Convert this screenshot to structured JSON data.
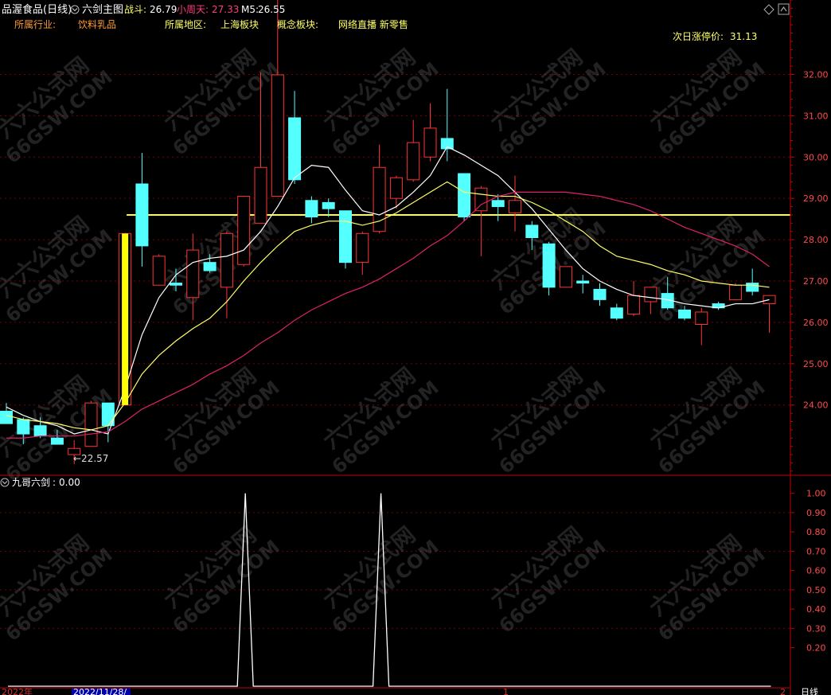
{
  "header": {
    "stock_name": "品渥食品(日线)",
    "indicator_name": "六剑主图",
    "zhandou_label": "战斗:",
    "zhandou_value": "26.79",
    "xiaozhoutian_label": "小周天:",
    "xiaozhoutian_value": "27.33",
    "m5_label": "M5:",
    "m5_value": "26.55"
  },
  "info": {
    "industry_label": "所属行业:",
    "industry_value": "饮料乳品",
    "region_label": "所属地区:",
    "region_value": "上海板块",
    "concept_label": "概念板块:",
    "concept_value": "网络直播 新零售",
    "limit_label": "次日涨停价:",
    "limit_value": "31.13"
  },
  "sub_header": {
    "name": "九哥六剑",
    "value": "0.00"
  },
  "bottom_bar": {
    "year": "2022年",
    "date": "2022/11/28/",
    "mark1": "1",
    "mark2": "2",
    "period": "日线"
  },
  "watermark": "六六公式网\n66GSW.COM",
  "colors": {
    "up": "#ff3333",
    "down": "#54ffff",
    "ma_white": "#ffffff",
    "ma_yellow": "#ffff66",
    "ma_pink": "#e0206a",
    "hline": "#ffff33",
    "grid": "#7a0000",
    "axis": "#c00000",
    "axis_text": "#ff4a4a"
  },
  "chart_data": [
    {
      "type": "candlestick",
      "title": "六剑主图",
      "ylim": [
        22.3,
        33.8
      ],
      "y_ticks": [
        24.0,
        25.0,
        26.0,
        27.0,
        28.0,
        29.0,
        30.0,
        31.0,
        32.0
      ],
      "y_tick_labels": [
        "24.00",
        "25.00",
        "26.00",
        "27.00",
        "28.00",
        "29.00",
        "30.00",
        "31.00",
        "32.00"
      ],
      "low_annotation": "←22.57",
      "hline_value": 28.6,
      "candles": [
        {
          "o": 23.85,
          "h": 24.05,
          "l": 23.55,
          "c": 23.55
        },
        {
          "o": 23.65,
          "h": 23.7,
          "l": 23.05,
          "c": 23.3
        },
        {
          "o": 23.5,
          "h": 23.7,
          "l": 23.2,
          "c": 23.25
        },
        {
          "o": 23.2,
          "h": 23.4,
          "l": 23.05,
          "c": 23.05
        },
        {
          "o": 22.8,
          "h": 23.15,
          "l": 22.57,
          "c": 22.95
        },
        {
          "o": 23.0,
          "h": 24.1,
          "l": 23.0,
          "c": 24.05
        },
        {
          "o": 24.05,
          "h": 24.05,
          "l": 23.1,
          "c": 23.5
        },
        {
          "o": 24.0,
          "h": 28.15,
          "l": 24.0,
          "c": 28.15
        },
        {
          "o": 29.35,
          "h": 30.1,
          "l": 27.35,
          "c": 27.85
        },
        {
          "o": 26.9,
          "h": 27.65,
          "l": 26.9,
          "c": 27.6
        },
        {
          "o": 26.95,
          "h": 27.3,
          "l": 26.75,
          "c": 26.9
        },
        {
          "o": 26.6,
          "h": 28.15,
          "l": 26.05,
          "c": 27.75
        },
        {
          "o": 27.45,
          "h": 27.65,
          "l": 27.2,
          "c": 27.25
        },
        {
          "o": 26.85,
          "h": 28.2,
          "l": 26.1,
          "c": 28.15
        },
        {
          "o": 27.4,
          "h": 29.05,
          "l": 27.35,
          "c": 29.05
        },
        {
          "o": 28.4,
          "h": 32.05,
          "l": 28.4,
          "c": 29.75
        },
        {
          "o": 29.05,
          "h": 33.8,
          "l": 29.05,
          "c": 31.99
        },
        {
          "o": 30.95,
          "h": 31.6,
          "l": 29.35,
          "c": 29.45
        },
        {
          "o": 28.95,
          "h": 29.05,
          "l": 28.4,
          "c": 28.55
        },
        {
          "o": 28.9,
          "h": 29.0,
          "l": 28.55,
          "c": 28.75
        },
        {
          "o": 28.7,
          "h": 28.7,
          "l": 27.3,
          "c": 27.45
        },
        {
          "o": 27.45,
          "h": 28.2,
          "l": 27.15,
          "c": 28.15
        },
        {
          "o": 28.2,
          "h": 30.3,
          "l": 28.15,
          "c": 29.75
        },
        {
          "o": 29.0,
          "h": 29.55,
          "l": 28.75,
          "c": 29.5
        },
        {
          "o": 29.45,
          "h": 30.9,
          "l": 29.4,
          "c": 30.35
        },
        {
          "o": 30.0,
          "h": 31.3,
          "l": 29.9,
          "c": 30.7
        },
        {
          "o": 30.45,
          "h": 31.65,
          "l": 29.9,
          "c": 30.2
        },
        {
          "o": 29.6,
          "h": 29.6,
          "l": 28.45,
          "c": 28.55
        },
        {
          "o": 28.7,
          "h": 29.3,
          "l": 27.6,
          "c": 29.25
        },
        {
          "o": 28.95,
          "h": 29.1,
          "l": 28.45,
          "c": 28.8
        },
        {
          "o": 28.65,
          "h": 29.55,
          "l": 28.2,
          "c": 28.95
        },
        {
          "o": 28.35,
          "h": 28.45,
          "l": 27.75,
          "c": 28.05
        },
        {
          "o": 27.9,
          "h": 27.95,
          "l": 26.65,
          "c": 26.85
        },
        {
          "o": 26.85,
          "h": 27.35,
          "l": 26.85,
          "c": 27.35
        },
        {
          "o": 27.0,
          "h": 27.15,
          "l": 26.7,
          "c": 26.95
        },
        {
          "o": 26.8,
          "h": 26.95,
          "l": 26.4,
          "c": 26.55
        },
        {
          "o": 26.35,
          "h": 26.45,
          "l": 26.05,
          "c": 26.1
        },
        {
          "o": 26.2,
          "h": 27.0,
          "l": 26.15,
          "c": 26.65
        },
        {
          "o": 26.5,
          "h": 26.85,
          "l": 26.2,
          "c": 26.85
        },
        {
          "o": 26.7,
          "h": 27.1,
          "l": 26.3,
          "c": 26.35
        },
        {
          "o": 26.3,
          "h": 26.4,
          "l": 26.05,
          "c": 26.1
        },
        {
          "o": 25.95,
          "h": 26.35,
          "l": 25.45,
          "c": 26.25
        },
        {
          "o": 26.45,
          "h": 26.5,
          "l": 26.3,
          "c": 26.35
        },
        {
          "o": 26.55,
          "h": 26.95,
          "l": 26.55,
          "c": 26.9
        },
        {
          "o": 26.95,
          "h": 27.3,
          "l": 26.65,
          "c": 26.75
        },
        {
          "o": 26.45,
          "h": 26.65,
          "l": 25.75,
          "c": 26.65
        }
      ],
      "series": [
        {
          "values": [
            23.95,
            23.75,
            23.6,
            23.5,
            23.3,
            23.4,
            23.3,
            24.4,
            25.7,
            26.6,
            27.15,
            27.45,
            27.55,
            27.6,
            27.75,
            28.2,
            28.8,
            29.5,
            29.8,
            29.75,
            29.2,
            28.7,
            28.6,
            28.8,
            29.15,
            29.55,
            30.25,
            30.05,
            29.8,
            29.55,
            29.15,
            28.75,
            28.25,
            27.75,
            27.3,
            27.0,
            26.8,
            26.65,
            26.6,
            26.55,
            26.45,
            26.4,
            26.35,
            26.45,
            26.45,
            26.55
          ]
        },
        {
          "values": [
            23.75,
            23.65,
            23.6,
            23.55,
            23.45,
            23.4,
            23.5,
            24.05,
            24.75,
            25.2,
            25.55,
            25.85,
            26.1,
            26.5,
            27.0,
            27.45,
            27.85,
            28.2,
            28.35,
            28.45,
            28.45,
            28.35,
            28.45,
            28.65,
            28.9,
            29.15,
            29.4,
            29.15,
            29.1,
            29.05,
            29.05,
            28.9,
            28.7,
            28.45,
            28.2,
            27.85,
            27.6,
            27.5,
            27.4,
            27.25,
            27.15,
            27.0,
            26.95,
            26.9,
            26.9,
            26.85
          ]
        },
        {
          "values": [
            23.2,
            23.2,
            23.25,
            23.25,
            23.25,
            23.3,
            23.35,
            23.6,
            23.9,
            24.1,
            24.3,
            24.5,
            24.75,
            24.95,
            25.2,
            25.5,
            25.75,
            26.05,
            26.3,
            26.5,
            26.7,
            26.85,
            27.05,
            27.3,
            27.55,
            27.85,
            28.1,
            28.45,
            28.85,
            29.05,
            29.15,
            29.15,
            29.15,
            29.15,
            29.1,
            29.05,
            28.95,
            28.85,
            28.7,
            28.5,
            28.3,
            28.15,
            28.0,
            27.85,
            27.65,
            27.35
          ]
        }
      ]
    },
    {
      "type": "line",
      "title": "九哥六剑",
      "ylim": [
        0,
        1.04
      ],
      "y_ticks": [
        0.2,
        0.3,
        0.4,
        0.5,
        0.6,
        0.7,
        0.8,
        0.9,
        1.0
      ],
      "y_tick_labels": [
        "0.20",
        "0.30",
        "0.40",
        "0.50",
        "0.60",
        "0.70",
        "0.80",
        "0.90",
        "1.00"
      ],
      "values": [
        0,
        0,
        0,
        0,
        0,
        0,
        0,
        0,
        0,
        0,
        0,
        0,
        0,
        0,
        1,
        0,
        0,
        0,
        0,
        0,
        0,
        0,
        1,
        0,
        0,
        0,
        0,
        0,
        0,
        0,
        0,
        0,
        0,
        0,
        0,
        0,
        0,
        0,
        0,
        0,
        0,
        0,
        0,
        0,
        0,
        0
      ]
    }
  ]
}
